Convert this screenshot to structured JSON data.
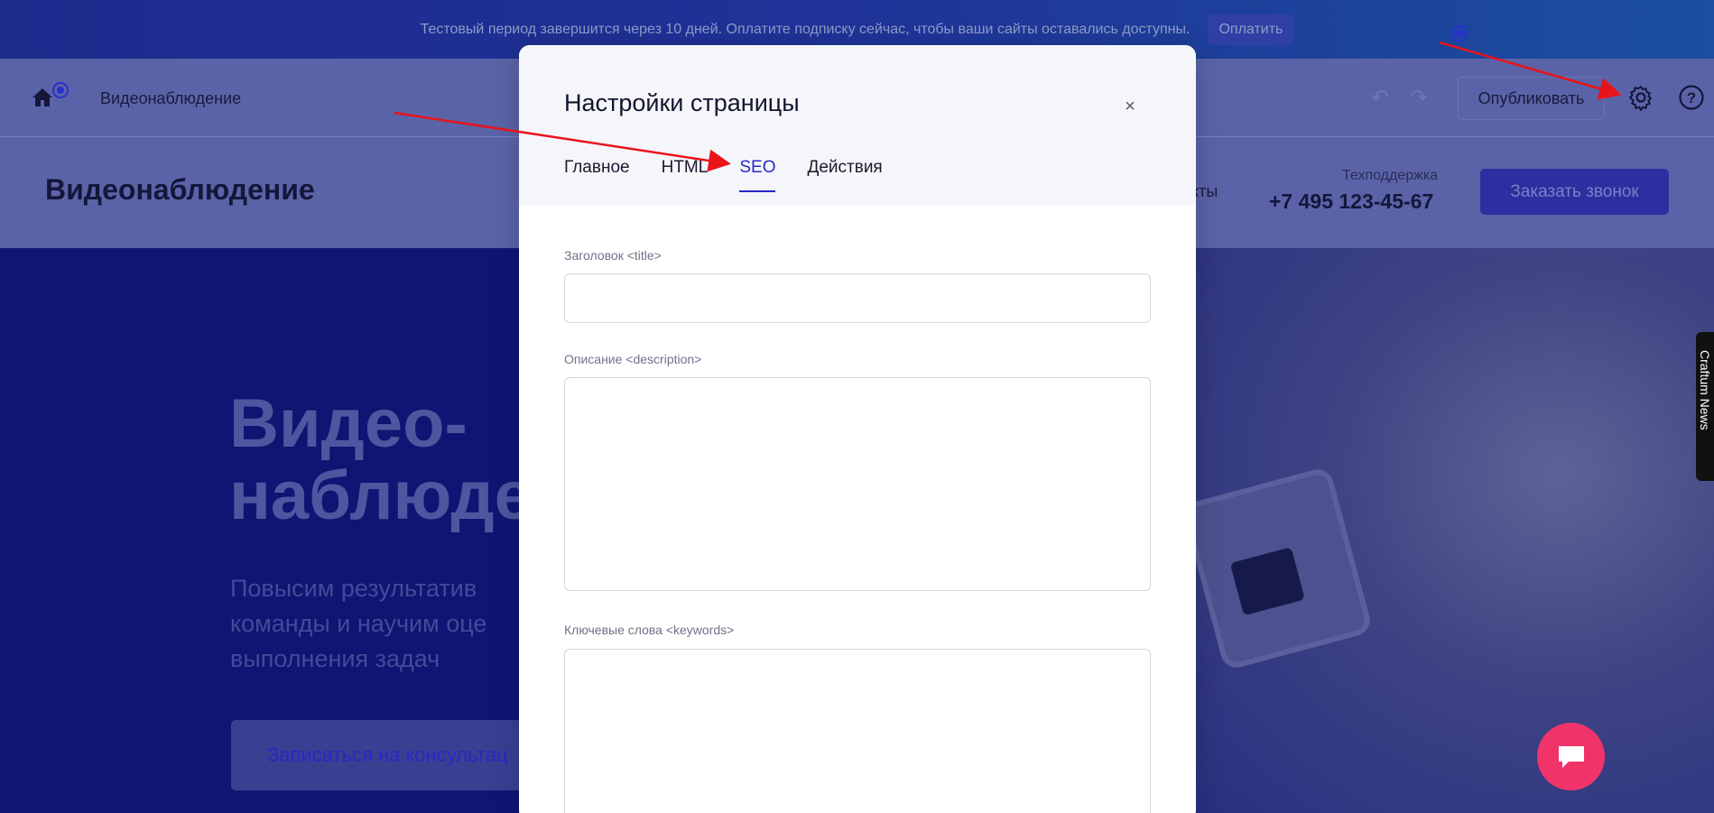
{
  "trial_banner": {
    "message": "Тестовый период завершится через 10 дней. Оплатите подписку сейчас, чтобы ваши сайты оставались доступны.",
    "pay_label": "Оплатить"
  },
  "editor": {
    "page_title": "Видеонаблюдение",
    "publish_label": "Опубликовать",
    "help_symbol": "?"
  },
  "site": {
    "logo": "Видеонаблюдение",
    "nav_contacts": "кты",
    "support_label": "Техподдержка",
    "support_phone": "+7 495 123-45-67",
    "callback_label": "Заказать звонок",
    "hero_title_line1": "Видео-",
    "hero_title_line2": "наблюде",
    "hero_sub_line1": "Повысим результатив",
    "hero_sub_line2": "команды и научим оце",
    "hero_sub_line3": "выполнения задач",
    "hero_button": "Записаться на консультац",
    "side_tab": "Craftum News"
  },
  "modal": {
    "title": "Настройки страницы",
    "close_symbol": "×",
    "tabs": [
      {
        "label": "Главное"
      },
      {
        "label": "HTML"
      },
      {
        "label": "SEO"
      },
      {
        "label": "Действия"
      }
    ],
    "active_tab": "SEO",
    "fields": {
      "title_label": "Заголовок <title>",
      "title_value": "",
      "description_label": "Описание <description>",
      "description_value": "",
      "keywords_label": "Ключевые слова <keywords>",
      "keywords_value": ""
    }
  },
  "colors": {
    "accent": "#2628c9",
    "annotation": "#e8141a",
    "chat_fab": "#f0346a"
  }
}
